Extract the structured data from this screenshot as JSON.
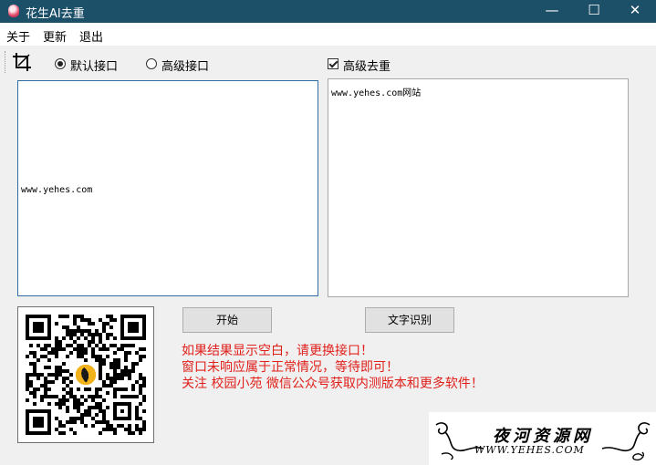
{
  "window": {
    "title": "花生AI去重",
    "controls": {
      "minimize": "—",
      "maximize": "☐",
      "close": "✕"
    }
  },
  "menu": {
    "about": {
      "label": "关于",
      "hotkey": ""
    },
    "update": {
      "label": "更新",
      "hotkey": ""
    },
    "exit": {
      "label": "退出",
      "hotkey": ""
    }
  },
  "toolbar": {
    "crop_icon": "crop-icon",
    "default_api": {
      "label": "默认接口",
      "checked": true
    },
    "advanced_api": {
      "label": "高级接口",
      "checked": false
    },
    "advanced_dedup": {
      "label": "高级去重",
      "checked": true
    }
  },
  "input_box": {
    "text": "www.yehes.com"
  },
  "output_box": {
    "text": "www.yehes.com网站"
  },
  "buttons": {
    "start": "开始",
    "ocr": "文字识别"
  },
  "messages": [
    "如果结果显示空白，请更换接口！",
    "窗口未响应属于正常情况，等待即可！",
    "关注 校园小苑 微信公众号获取内测版本和更多软件！"
  ],
  "watermark": {
    "title": "夜河资源网",
    "url": "WWW.YEHES.COM"
  },
  "colors": {
    "titlebar": "#1c4f68",
    "message": "#e0201b",
    "focus_border": "#2f6ea5"
  }
}
